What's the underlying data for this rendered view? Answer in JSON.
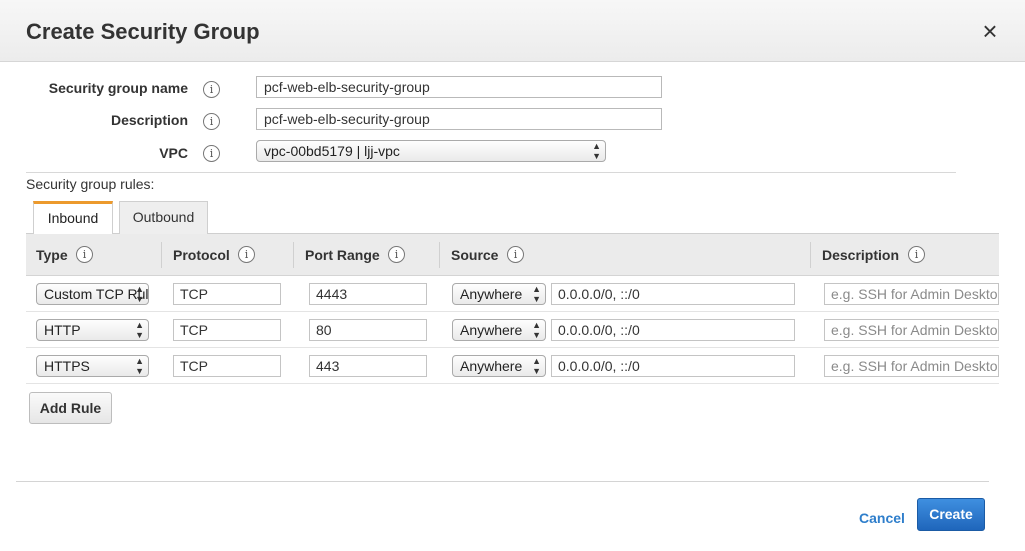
{
  "dialog": {
    "title": "Create Security Group",
    "close_symbol": "×"
  },
  "form": {
    "name_label": "Security group name",
    "name_value": "pcf-web-elb-security-group",
    "description_label": "Description",
    "description_value": "pcf-web-elb-security-group",
    "vpc_label": "VPC",
    "vpc_value": "vpc-00bd5179 | ljj-vpc",
    "info_symbol": "i"
  },
  "rules": {
    "section_label": "Security group rules:",
    "tabs": [
      {
        "label": "Inbound",
        "active": true
      },
      {
        "label": "Outbound",
        "active": false
      }
    ],
    "columns": {
      "type": "Type",
      "protocol": "Protocol",
      "port_range": "Port Range",
      "source": "Source",
      "description": "Description"
    },
    "rows": [
      {
        "type": "Custom TCP Rule",
        "protocol": "TCP",
        "port_range": "4443",
        "source_type": "Anywhere",
        "source_cidr": "0.0.0.0/0, ::/0",
        "description_placeholder": "e.g. SSH for Admin Desktop"
      },
      {
        "type": "HTTP",
        "protocol": "TCP",
        "port_range": "80",
        "source_type": "Anywhere",
        "source_cidr": "0.0.0.0/0, ::/0",
        "description_placeholder": "e.g. SSH for Admin Desktop"
      },
      {
        "type": "HTTPS",
        "protocol": "TCP",
        "port_range": "443",
        "source_type": "Anywhere",
        "source_cidr": "0.0.0.0/0, ::/0",
        "description_placeholder": "e.g. SSH for Admin Desktop"
      }
    ],
    "add_rule_label": "Add Rule"
  },
  "footer": {
    "cancel_label": "Cancel",
    "create_label": "Create"
  },
  "colors": {
    "primary_button": "#2f7fd4",
    "link": "#2e7ecb",
    "active_tab_accent": "#ec9a2d"
  },
  "icons": {
    "close": "close-icon",
    "info": "info-icon",
    "select_arrows": "select-arrows-icon"
  }
}
